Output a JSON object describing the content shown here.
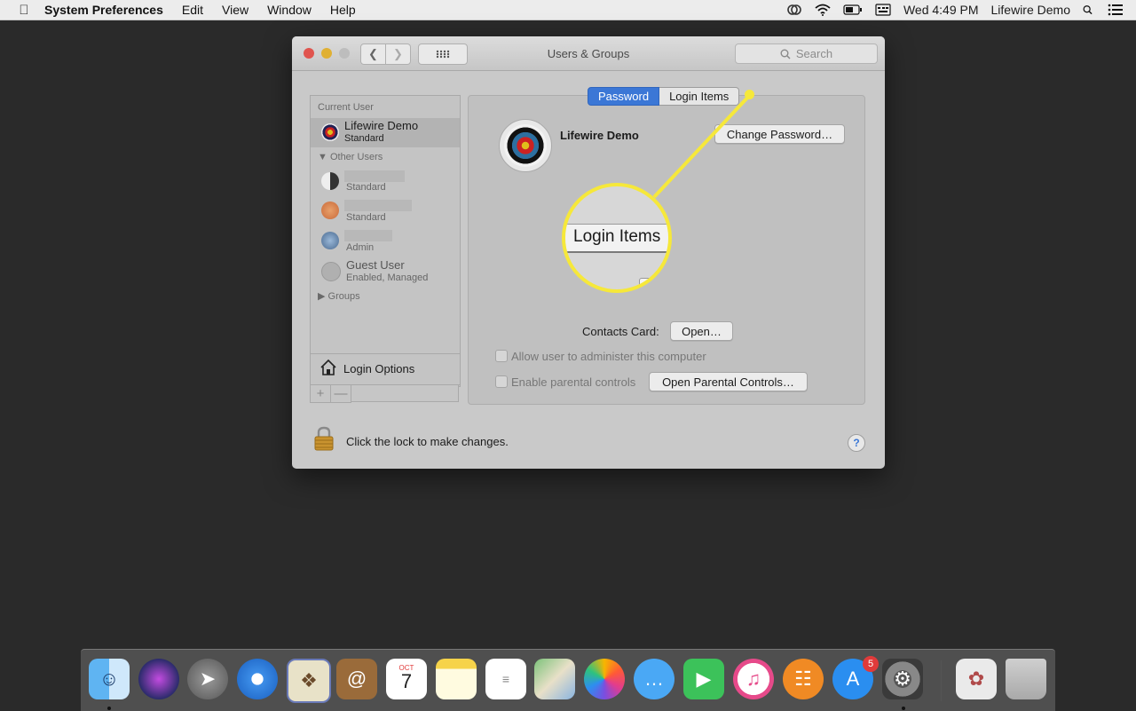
{
  "menubar": {
    "app_name": "System Preferences",
    "items": [
      "Edit",
      "View",
      "Window",
      "Help"
    ],
    "clock": "Wed 4:49 PM",
    "user": "Lifewire Demo"
  },
  "window": {
    "title": "Users & Groups",
    "search_placeholder": "Search"
  },
  "sidebar": {
    "current_user_header": "Current User",
    "current_user": {
      "name": "Lifewire Demo",
      "role": "Standard"
    },
    "other_users_header": "Other Users",
    "other_users": [
      {
        "role": "Standard"
      },
      {
        "role": "Standard"
      },
      {
        "role": "Admin"
      }
    ],
    "guest": {
      "name": "Guest User",
      "status": "Enabled, Managed"
    },
    "groups_label": "Groups",
    "login_options_label": "Login Options",
    "add_label": "+",
    "remove_label": "—"
  },
  "panel": {
    "tabs": [
      {
        "label": "Password",
        "selected": true
      },
      {
        "label": "Login Items",
        "selected": false
      }
    ],
    "user_name": "Lifewire Demo",
    "change_password_label": "Change Password…",
    "contacts_card_label": "Contacts Card:",
    "open_label": "Open…",
    "allow_admin_label": "Allow user to administer this computer",
    "parental_controls_label": "Enable parental controls",
    "open_parental_controls_label": "Open Parental Controls…"
  },
  "footer": {
    "lock_text": "Click the lock to make changes.",
    "help_label": "?"
  },
  "callout": {
    "magnified_text": "Login Items",
    "color": "#f6e83a"
  },
  "dock": {
    "items": [
      "finder-icon",
      "siri-icon",
      "launchpad-icon",
      "safari-icon",
      "mail-icon",
      "contacts-icon",
      "calendar-icon",
      "notes-icon",
      "reminders-icon",
      "maps-icon",
      "photos-icon",
      "messages-icon",
      "facetime-icon",
      "itunes-icon",
      "ibooks-icon",
      "app-store-icon",
      "system-preferences-icon",
      "preview-icon",
      "trash-icon"
    ],
    "calendar_month": "OCT",
    "calendar_day": "7",
    "app_store_badge": "5"
  }
}
